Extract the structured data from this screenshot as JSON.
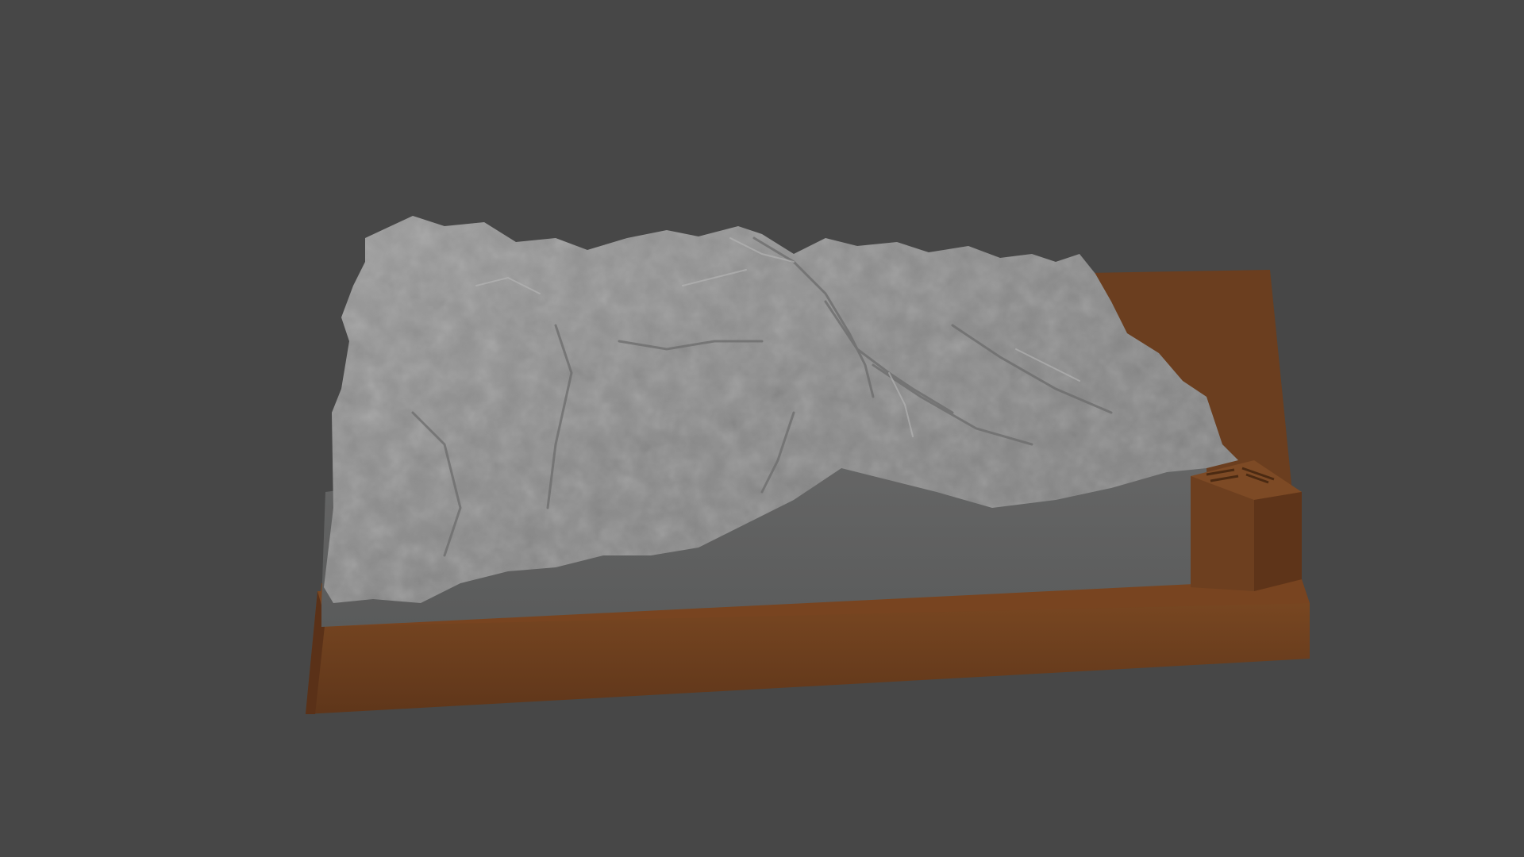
{
  "scene": {
    "background_color": "#474747",
    "terrain_color": "#8e8e8e",
    "terrain_side_color": "#5f6060",
    "base_color": "#6b3e1f",
    "label_block_color": "#6d3f1f",
    "label_block_icons": [
      "compass-arrow-icon",
      "north-arrow-icon"
    ]
  }
}
